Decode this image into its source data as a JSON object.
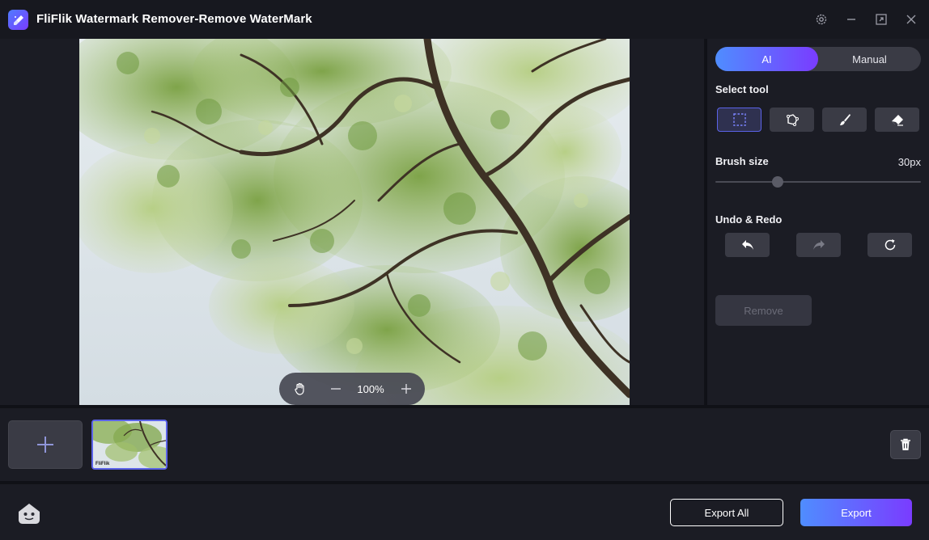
{
  "app": {
    "title": "FliFlik Watermark Remover-Remove WaterMark",
    "logo_icon": "broom-icon"
  },
  "window_controls": [
    "settings-icon",
    "minimize-icon",
    "maximize-icon",
    "close-icon"
  ],
  "canvas": {
    "zoom_value": "100%",
    "zoom_tools": [
      "hand-icon",
      "zoom-out-icon",
      "zoom-in-icon"
    ]
  },
  "panel": {
    "modes": {
      "ai": "AI",
      "manual": "Manual",
      "active": "AI"
    },
    "select_tool_label": "Select tool",
    "tools": [
      "rectangle-select-icon",
      "lasso-icon",
      "brush-icon",
      "eraser-icon"
    ],
    "active_tool": "rectangle-select-icon",
    "brush_size_label": "Brush size",
    "brush_size_value": "30px",
    "brush_size_level": 0.3,
    "undo_redo_label": "Undo & Redo",
    "undo_redo_tools": [
      "undo-icon",
      "redo-icon",
      "reset-icon"
    ],
    "remove_label": "Remove"
  },
  "thumbnails": {
    "items": [
      {
        "tag": "FliFlik"
      }
    ]
  },
  "bottom": {
    "export_all_label": "Export All",
    "export_label": "Export"
  },
  "colors": {
    "accent_start": "#4f8dff",
    "accent_end": "#7a3cff",
    "background": "#1b1c24",
    "button": "#3a3b45"
  }
}
